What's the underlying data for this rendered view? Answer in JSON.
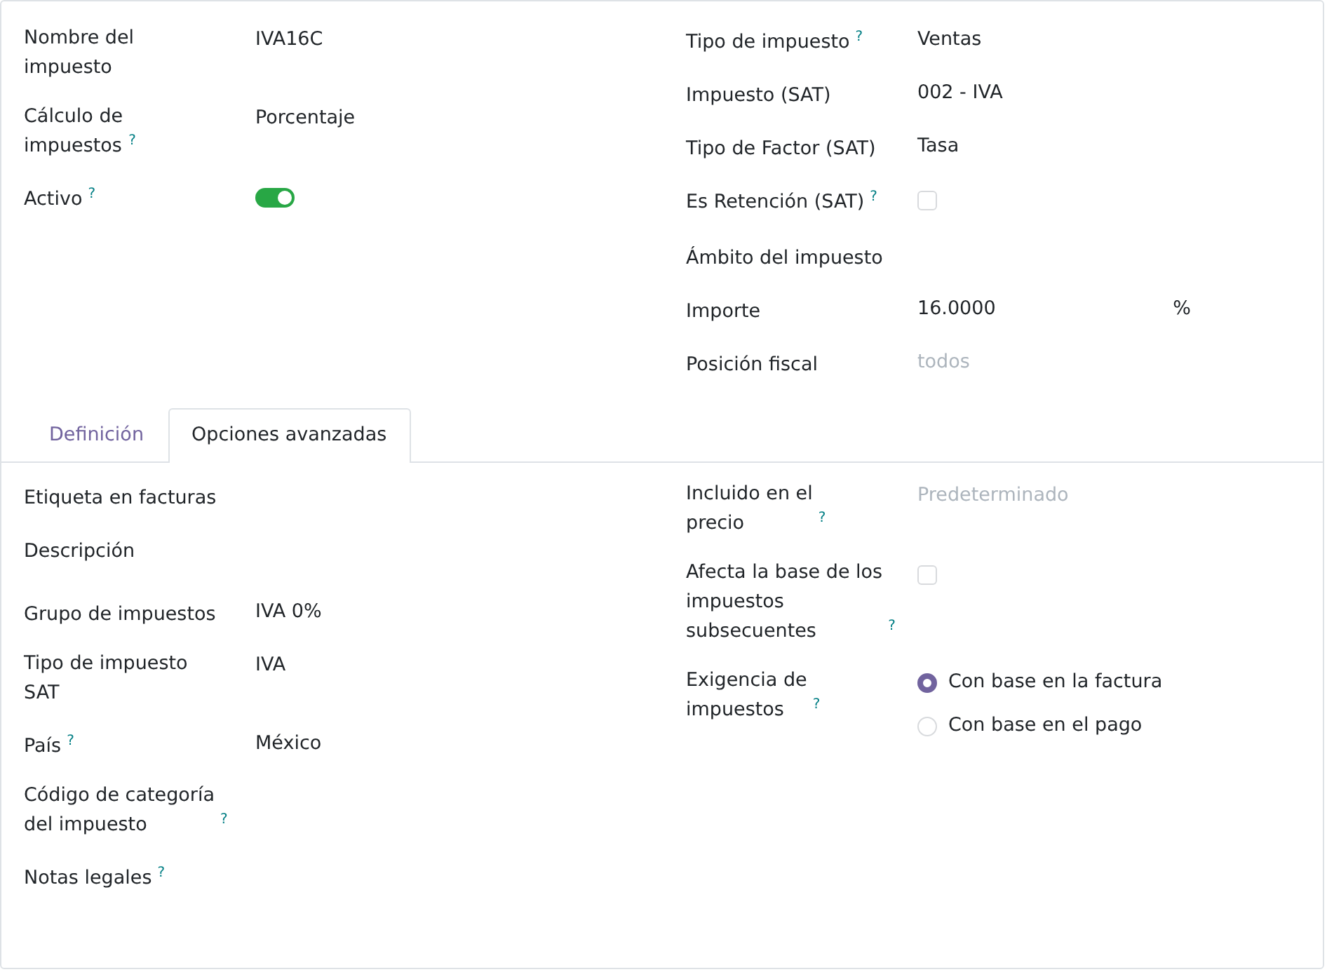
{
  "top": {
    "left": [
      {
        "label": "Nombre del\nimpuesto",
        "kind": "text",
        "value": "IVA16C"
      },
      {
        "label": "Cálculo de\nimpuestos",
        "help": "?",
        "kind": "text",
        "value": "Porcentaje"
      },
      {
        "label": "Activo",
        "help": "?",
        "kind": "toggle",
        "on": true
      }
    ],
    "right": [
      {
        "label": "Tipo de impuesto",
        "help": "?",
        "kind": "text",
        "value": "Ventas"
      },
      {
        "label": "Impuesto (SAT)",
        "kind": "text",
        "value": "002 - IVA"
      },
      {
        "label": "Tipo de Factor (SAT)",
        "kind": "text",
        "value": "Tasa"
      },
      {
        "label": "Es Retención (SAT)",
        "help": "?",
        "kind": "checkbox",
        "checked": false
      },
      {
        "label": "Ámbito del impuesto",
        "kind": "empty"
      },
      {
        "label": "Importe",
        "kind": "amount",
        "value": "16.0000",
        "unit": "%"
      },
      {
        "label": "Posición fiscal",
        "kind": "placeholder",
        "placeholder": "todos"
      }
    ]
  },
  "tabs": [
    {
      "label": "Definición",
      "selected": false
    },
    {
      "label": "Opciones avanzadas",
      "selected": true
    }
  ],
  "advanced": {
    "left": [
      {
        "label": "Etiqueta en facturas",
        "kind": "empty"
      },
      {
        "label": "Descripción",
        "kind": "textarea"
      },
      {
        "label": "Grupo de impuestos",
        "kind": "text",
        "value": "IVA 0%"
      },
      {
        "label": "Tipo de impuesto\nSAT",
        "kind": "text",
        "value": "IVA"
      },
      {
        "label": "País",
        "help": "?",
        "kind": "text",
        "value": "México"
      },
      {
        "label": "Código de categoría\ndel impuesto",
        "help": "?",
        "kind": "empty"
      },
      {
        "label": "Notas legales",
        "help": "?",
        "kind": "empty"
      }
    ],
    "right": [
      {
        "label": "Incluido en el\nprecio",
        "help": "?",
        "kind": "placeholder",
        "placeholder": "Predeterminado"
      },
      {
        "label": "Afecta la base de los\nimpuestos\nsubsecuentes",
        "help": "?",
        "kind": "checkbox",
        "checked": false
      },
      {
        "label": "Exigencia de\nimpuestos",
        "help": "?",
        "kind": "radio",
        "options": [
          {
            "label": "Con base en la factura",
            "selected": true
          },
          {
            "label": "Con base en el pago",
            "selected": false
          }
        ]
      }
    ]
  }
}
